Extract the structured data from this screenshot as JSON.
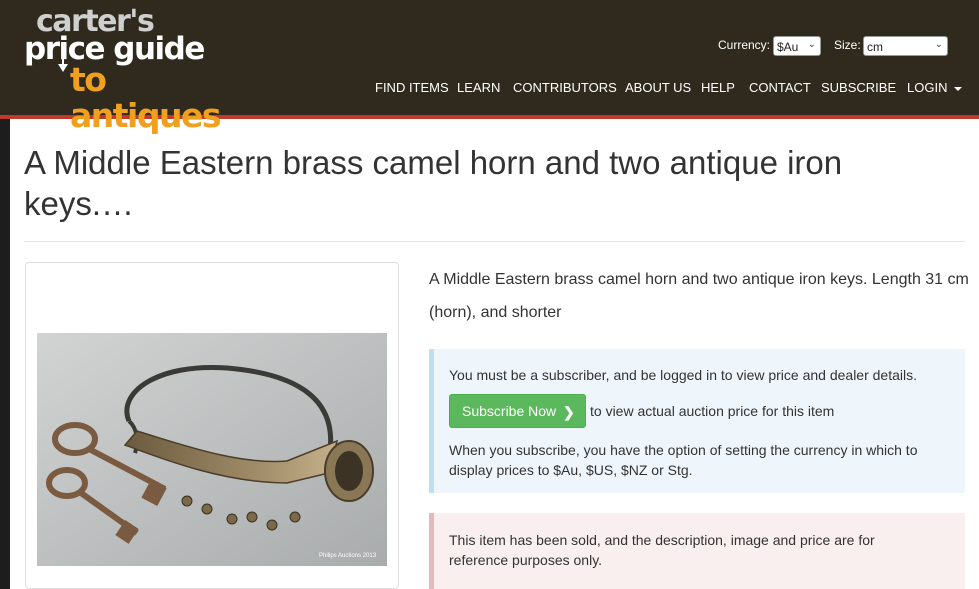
{
  "header": {
    "logo": {
      "line1": "carter's",
      "line2": "price guide",
      "line3": "to antiques"
    },
    "currency": {
      "label": "Currency:",
      "value": "$Au"
    },
    "size": {
      "label": "Size:",
      "value": "cm"
    },
    "nav": [
      "FIND ITEMS",
      "LEARN",
      "CONTRIBUTORS",
      "ABOUT US",
      "HELP",
      "CONTACT",
      "SUBSCRIBE",
      "LOGIN"
    ]
  },
  "colors": {
    "header_bg": "#2f2a1d",
    "accent_red": "#c0392b",
    "logo_orange": "#f0a01e",
    "subscribe_green": "#5cb85c"
  },
  "item": {
    "title": "A Middle Eastern brass camel horn and two antique iron keys.…",
    "description": "A Middle Eastern brass camel horn and two antique iron keys. Length 31 cm (horn), and shorter",
    "photo_caption": "Philips Auctions 2013"
  },
  "info": {
    "subscriber_notice": "You must be a subscriber, and be logged in to view price and dealer details.",
    "subscribe_button": "Subscribe Now",
    "subscribe_after": "to view actual auction price for this item",
    "currency_notice": "When you subscribe, you have the option of setting the currency in which to display prices to $Au, $US, $NZ or Stg."
  },
  "sold": {
    "text": "This item has been sold, and the description, image and price are for reference purposes only."
  }
}
